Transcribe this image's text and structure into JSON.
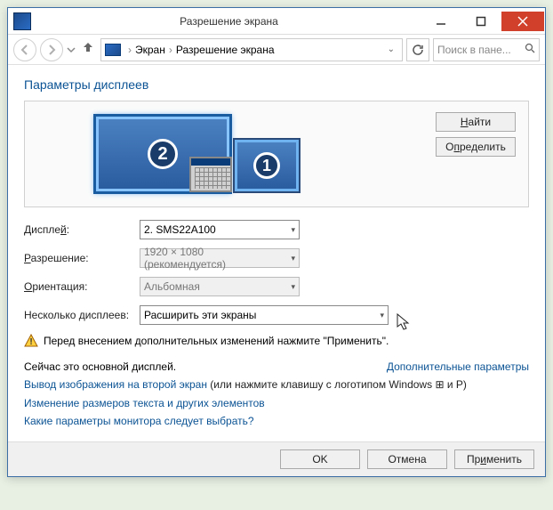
{
  "window": {
    "title": "Разрешение экрана"
  },
  "navbar": {
    "breadcrumb": {
      "root": "Экран",
      "current": "Разрешение экрана"
    },
    "search_placeholder": "Поиск в пане..."
  },
  "heading": "Параметры дисплеев",
  "monitors": {
    "m2": "2",
    "m1": "1"
  },
  "side_buttons": {
    "find": "Найти",
    "identify": "Определить"
  },
  "rows": {
    "display_label": "Дисплей:",
    "display_value": "2. SMS22A100",
    "resolution_label": "Разрешение:",
    "resolution_value": "1920 × 1080 (рекомендуется)",
    "orientation_label": "Ориентация:",
    "orientation_value": "Альбомная",
    "multi_label": "Несколько дисплеев:",
    "multi_value": "Расширить эти экраны"
  },
  "warning": "Перед внесением дополнительных изменений нажмите \"Применить\".",
  "main_display_text": "Сейчас это основной дисплей.",
  "advanced_link": "Дополнительные параметры",
  "link_project_pre": "Вывод изображения на второй экран",
  "link_project_post": " (или нажмите клавишу с логотипом Windows ",
  "link_project_tail": " и P)",
  "link_textsize": "Изменение размеров текста и других элементов",
  "link_which": "Какие параметры монитора следует выбрать?",
  "footer": {
    "ok": "OK",
    "cancel": "Отмена",
    "apply": "Применить"
  }
}
